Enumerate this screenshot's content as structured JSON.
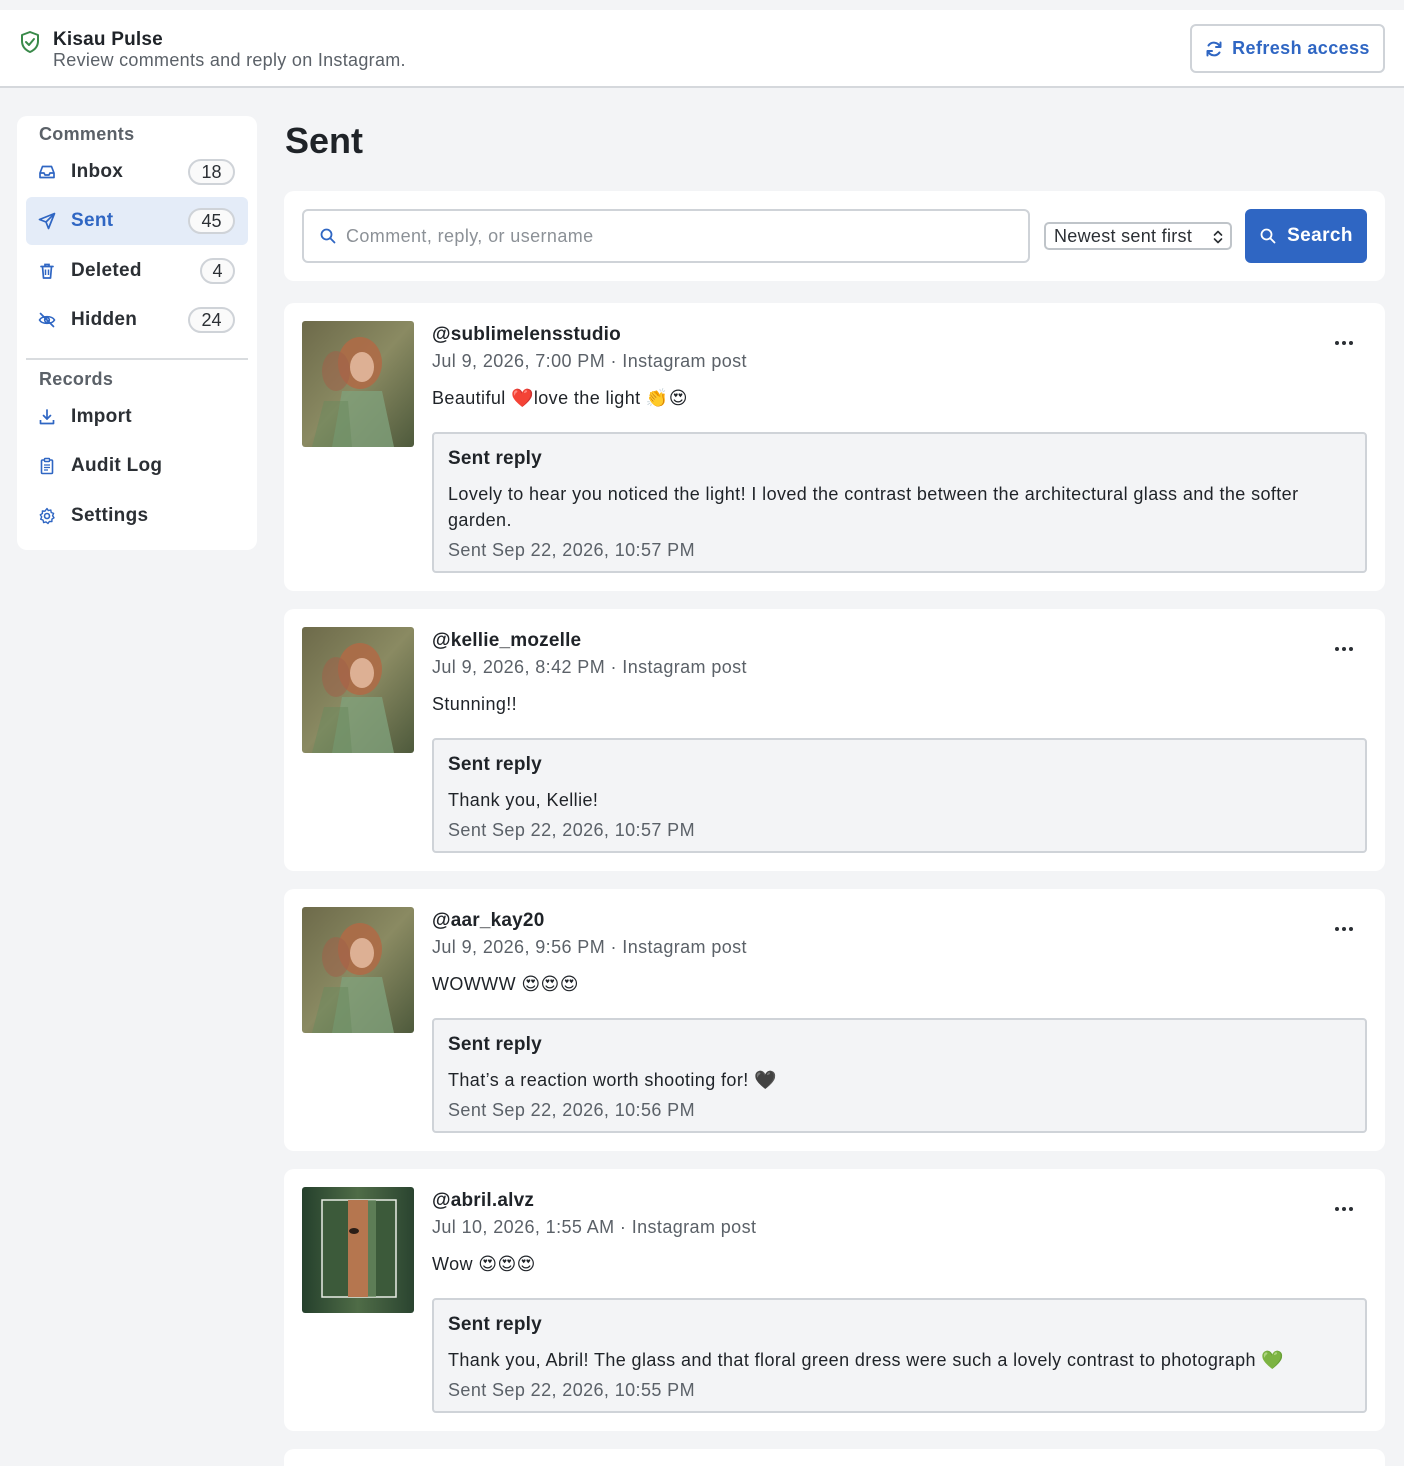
{
  "header": {
    "app_title": "Kisau Pulse",
    "app_subtitle": "Review comments and reply on Instagram.",
    "refresh_label": "Refresh access"
  },
  "sidebar": {
    "comments_heading": "Comments",
    "records_heading": "Records",
    "items": [
      {
        "label": "Inbox",
        "count": "18",
        "icon": "inbox-icon",
        "active": false
      },
      {
        "label": "Sent",
        "count": "45",
        "icon": "send-icon",
        "active": true
      },
      {
        "label": "Deleted",
        "count": "4",
        "icon": "trash-icon",
        "active": false
      },
      {
        "label": "Hidden",
        "count": "24",
        "icon": "eye-off-icon",
        "active": false
      }
    ],
    "records": [
      {
        "label": "Import",
        "icon": "download-icon"
      },
      {
        "label": "Audit Log",
        "icon": "clipboard-icon"
      },
      {
        "label": "Settings",
        "icon": "gear-icon"
      }
    ]
  },
  "main": {
    "page_title": "Sent",
    "search": {
      "placeholder": "Comment, reply, or username",
      "value": "",
      "sort_selected": "Newest sent first",
      "button_label": "Search"
    },
    "cards": [
      {
        "username": "@sublimelensstudio",
        "meta": "Jul 9, 2026, 7:00 PM · Instagram post",
        "comment": "Beautiful ❤️love the light 👏😍",
        "reply_title": "Sent reply",
        "reply_text": "Lovely to hear you noticed the light! I loved the contrast between the architectural glass and the softer garden.",
        "reply_date": "Sent Sep 22, 2026, 10:57 PM"
      },
      {
        "username": "@kellie_mozelle",
        "meta": "Jul 9, 2026, 8:42 PM · Instagram post",
        "comment": "Stunning!!",
        "reply_title": "Sent reply",
        "reply_text": "Thank you, Kellie!",
        "reply_date": "Sent Sep 22, 2026, 10:57 PM"
      },
      {
        "username": "@aar_kay20",
        "meta": "Jul 9, 2026, 9:56 PM · Instagram post",
        "comment": "WOWWW 😍😍😍",
        "reply_title": "Sent reply",
        "reply_text": "That’s a reaction worth shooting for! 🖤",
        "reply_date": "Sent Sep 22, 2026, 10:56 PM"
      },
      {
        "username": "@abril.alvz",
        "meta": "Jul 10, 2026, 1:55 AM · Instagram post",
        "comment": "Wow 😍😍😍",
        "reply_title": "Sent reply",
        "reply_text": "Thank you, Abril! The glass and that floral green dress were such a lovely contrast to photograph 💚",
        "reply_date": "Sent Sep 22, 2026, 10:55 PM"
      }
    ]
  },
  "colors": {
    "accent": "#2f66c3",
    "active_bg": "#e4ecf8",
    "shield": "#3a8a4a",
    "page_bg": "#f3f4f6"
  }
}
